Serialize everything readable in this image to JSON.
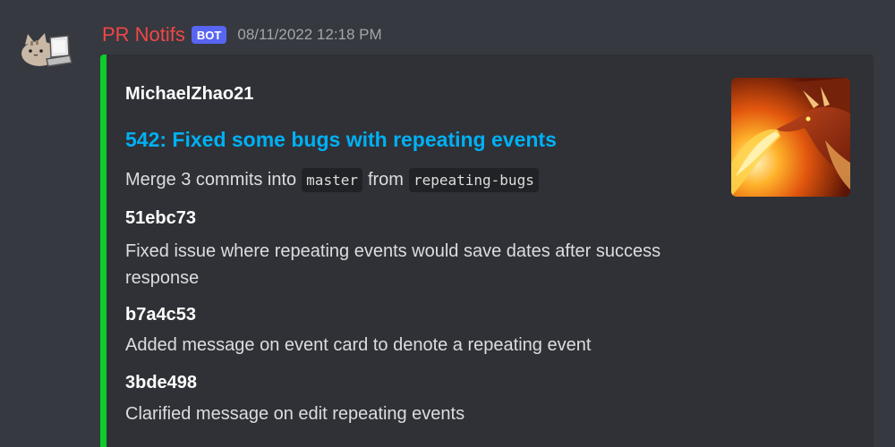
{
  "message": {
    "username": "PR Notifs",
    "bot_tag": "BOT",
    "timestamp": "08/11/2022 12:18 PM",
    "username_color": "#f04747",
    "avatar_icon": "pusheen-cat-laptop-icon"
  },
  "embed": {
    "accent_color": "#0fcb2c",
    "author": "MichaelZhao21",
    "title": "542: Fixed some bugs with repeating events",
    "description": {
      "prefix": "Merge 3 commits into",
      "base_branch": "master",
      "middle": "from",
      "head_branch": "repeating-bugs"
    },
    "thumbnail": "dragon-breathing-fire-image",
    "commits": [
      {
        "sha": "51ebc73",
        "message": "Fixed issue where repeating events would save dates after success response"
      },
      {
        "sha": "b7a4c53",
        "message": "Added message on event card to denote a repeating event"
      },
      {
        "sha": "3bde498",
        "message": "Clarified message on edit repeating events"
      }
    ]
  }
}
